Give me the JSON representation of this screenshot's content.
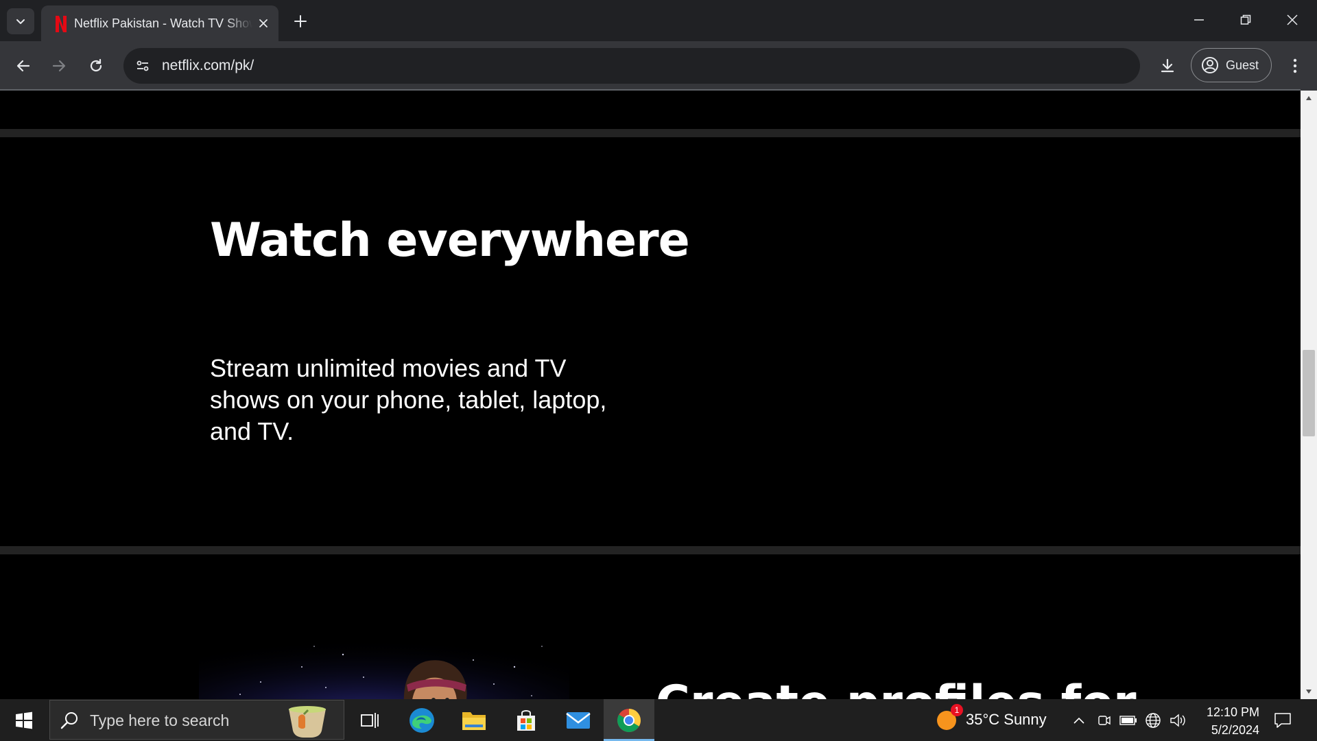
{
  "browser": {
    "tab": {
      "title": "Netflix Pakistan - Watch TV Shows Online, Watch Movies Online",
      "favicon": "netflix-n-icon"
    },
    "new_tab_icon": "plus-icon",
    "address_bar": {
      "url": "netflix.com/pk/"
    },
    "profile": {
      "label": "Guest"
    },
    "colors": {
      "tab_bar": "#202124",
      "toolbar": "#35363a",
      "omnibox": "#202124"
    }
  },
  "page": {
    "section": {
      "heading": "Watch everywhere",
      "body": "Stream unlimited movies and TV shows on your phone, tablet, laptop, and TV."
    },
    "next_section": {
      "heading_partial": "Create profiles for"
    },
    "colors": {
      "background": "#000000",
      "divider": "#232323",
      "text": "#ffffff",
      "brand": "#e50914"
    }
  },
  "taskbar": {
    "search": {
      "placeholder": "Type here to search"
    },
    "apps": [
      "task-view-icon",
      "edge-icon",
      "file-explorer-icon",
      "microsoft-store-icon",
      "mail-icon",
      "chrome-icon"
    ],
    "weather": {
      "text": "35°C  Sunny",
      "badge": "1"
    },
    "clock": {
      "time": "12:10 PM",
      "date": "5/2/2024"
    }
  }
}
